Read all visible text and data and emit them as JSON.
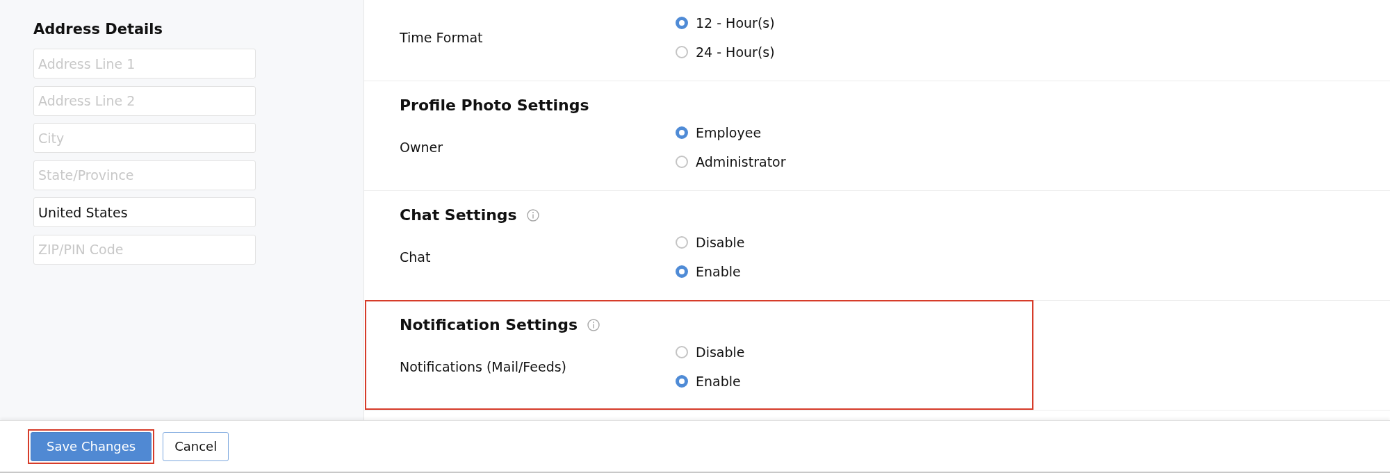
{
  "address": {
    "title": "Address Details",
    "fields": [
      {
        "placeholder": "Address Line 1"
      },
      {
        "placeholder": "Address Line 2"
      },
      {
        "placeholder": "City"
      },
      {
        "placeholder": "State/Province"
      },
      {
        "value": "United States"
      },
      {
        "placeholder": "ZIP/PIN Code"
      }
    ]
  },
  "sections": [
    {
      "label": "Time Format",
      "highlighted": false,
      "options": [
        {
          "label": "12 - Hour(s)",
          "selected": true
        },
        {
          "label": "24 - Hour(s)",
          "selected": false
        }
      ]
    },
    {
      "title": "Profile Photo Settings",
      "info": false,
      "label": "Owner",
      "highlighted": false,
      "options": [
        {
          "label": "Employee",
          "selected": true
        },
        {
          "label": "Administrator",
          "selected": false
        }
      ]
    },
    {
      "title": "Chat Settings",
      "info": true,
      "label": "Chat",
      "highlighted": false,
      "options": [
        {
          "label": "Disable",
          "selected": false
        },
        {
          "label": "Enable",
          "selected": true
        }
      ]
    },
    {
      "title": "Notification Settings",
      "info": true,
      "label": "Notifications (Mail/Feeds)",
      "highlighted": true,
      "options": [
        {
          "label": "Disable",
          "selected": false
        },
        {
          "label": "Enable",
          "selected": true
        }
      ]
    }
  ],
  "footer": {
    "buttons": [
      {
        "label": "Save Changes",
        "kind": "primary",
        "highlighted": true
      },
      {
        "label": "Cancel",
        "kind": "secondary",
        "highlighted": false
      }
    ]
  }
}
